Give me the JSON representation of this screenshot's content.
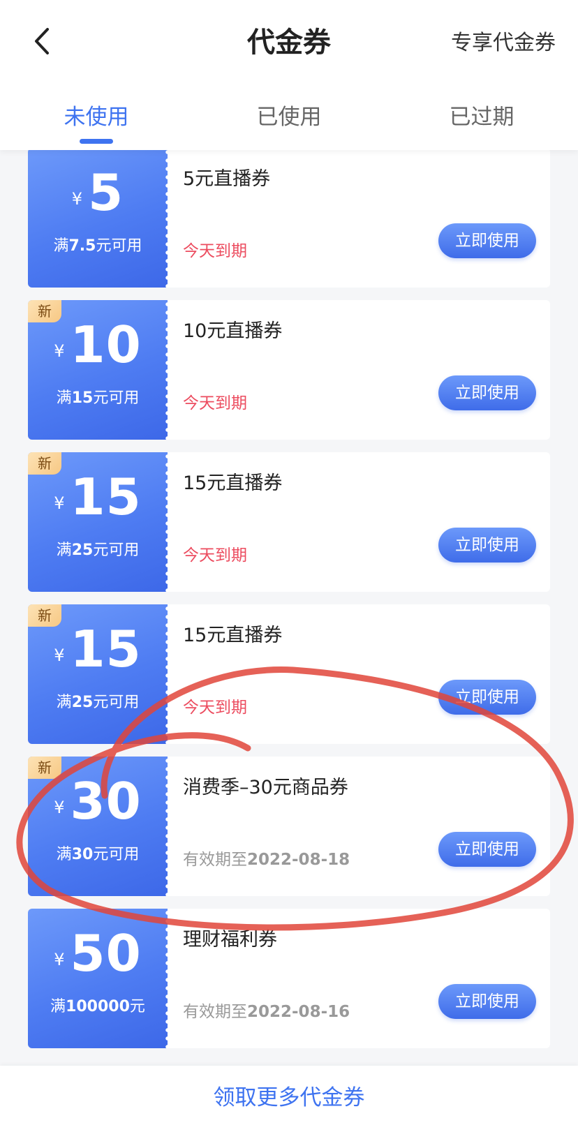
{
  "header": {
    "title": "代金券",
    "exclusive_label": "专享代金券"
  },
  "tabs": [
    {
      "label": "未使用",
      "active": true
    },
    {
      "label": "已使用",
      "active": false
    },
    {
      "label": "已过期",
      "active": false
    }
  ],
  "currency_symbol": "¥",
  "use_button_label": "立即使用",
  "new_badge_label": "新",
  "coupons": [
    {
      "amount": "5",
      "cond_prefix": "满",
      "cond_value": "7.5",
      "cond_suffix": "元可用",
      "name": "5元直播券",
      "expiry_text": "今天到期",
      "expiry_prefix": "",
      "expiry_date": "",
      "is_new": false
    },
    {
      "amount": "10",
      "cond_prefix": "满",
      "cond_value": "15",
      "cond_suffix": "元可用",
      "name": "10元直播券",
      "expiry_text": "今天到期",
      "expiry_prefix": "",
      "expiry_date": "",
      "is_new": true
    },
    {
      "amount": "15",
      "cond_prefix": "满",
      "cond_value": "25",
      "cond_suffix": "元可用",
      "name": "15元直播券",
      "expiry_text": "今天到期",
      "expiry_prefix": "",
      "expiry_date": "",
      "is_new": true
    },
    {
      "amount": "15",
      "cond_prefix": "满",
      "cond_value": "25",
      "cond_suffix": "元可用",
      "name": "15元直播券",
      "expiry_text": "今天到期",
      "expiry_prefix": "",
      "expiry_date": "",
      "is_new": true
    },
    {
      "amount": "30",
      "cond_prefix": "满",
      "cond_value": "30",
      "cond_suffix": "元可用",
      "name": "消费季–30元商品券",
      "expiry_text": "",
      "expiry_prefix": "有效期至",
      "expiry_date": "2022-08-18",
      "is_new": true
    },
    {
      "amount": "50",
      "cond_prefix": "满",
      "cond_value": "100000",
      "cond_suffix": "元",
      "name": "理财福利券",
      "expiry_text": "",
      "expiry_prefix": "有效期至",
      "expiry_date": "2022-08-16",
      "is_new": false
    }
  ],
  "footer": {
    "more_label": "领取更多代金券"
  },
  "colors": {
    "accent": "#3e73f0",
    "expiry_today": "#ec4c5f",
    "annotation": "#e0453a"
  },
  "icons": {
    "back": "chevron-left-icon"
  }
}
